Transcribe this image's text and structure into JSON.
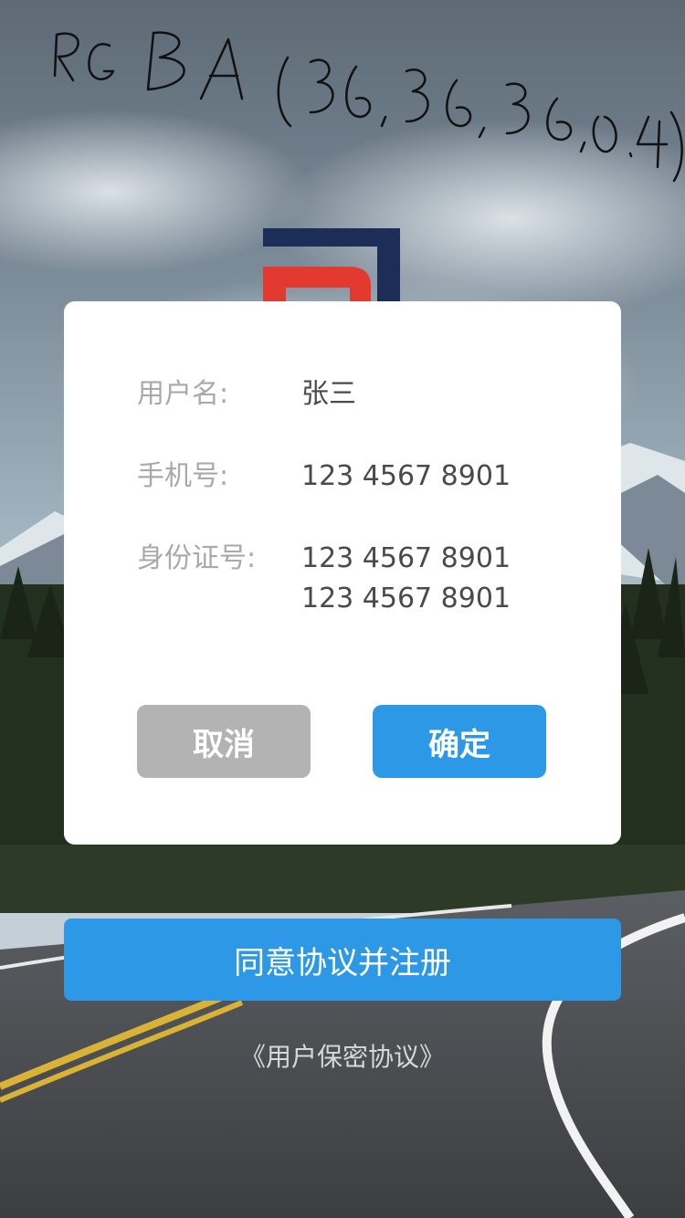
{
  "annotation_text": "RGBA(36,36,36,0.4)",
  "dialog": {
    "fields": [
      {
        "label": "用户名:",
        "value": "张三"
      },
      {
        "label": "手机号:",
        "value": "123 4567 8901"
      },
      {
        "label": "身份证号:",
        "value": "123 4567 8901",
        "value2": "123 4567 8901"
      }
    ],
    "cancel_label": "取消",
    "confirm_label": "确定"
  },
  "register_label": "同意协议并注册",
  "agreement_link": "《用户保密协议》",
  "colors": {
    "primary_blue": "#2d99e6",
    "cancel_gray": "#b3b3b3",
    "logo_red": "#e23a2e",
    "logo_navy": "#1c2e57"
  }
}
